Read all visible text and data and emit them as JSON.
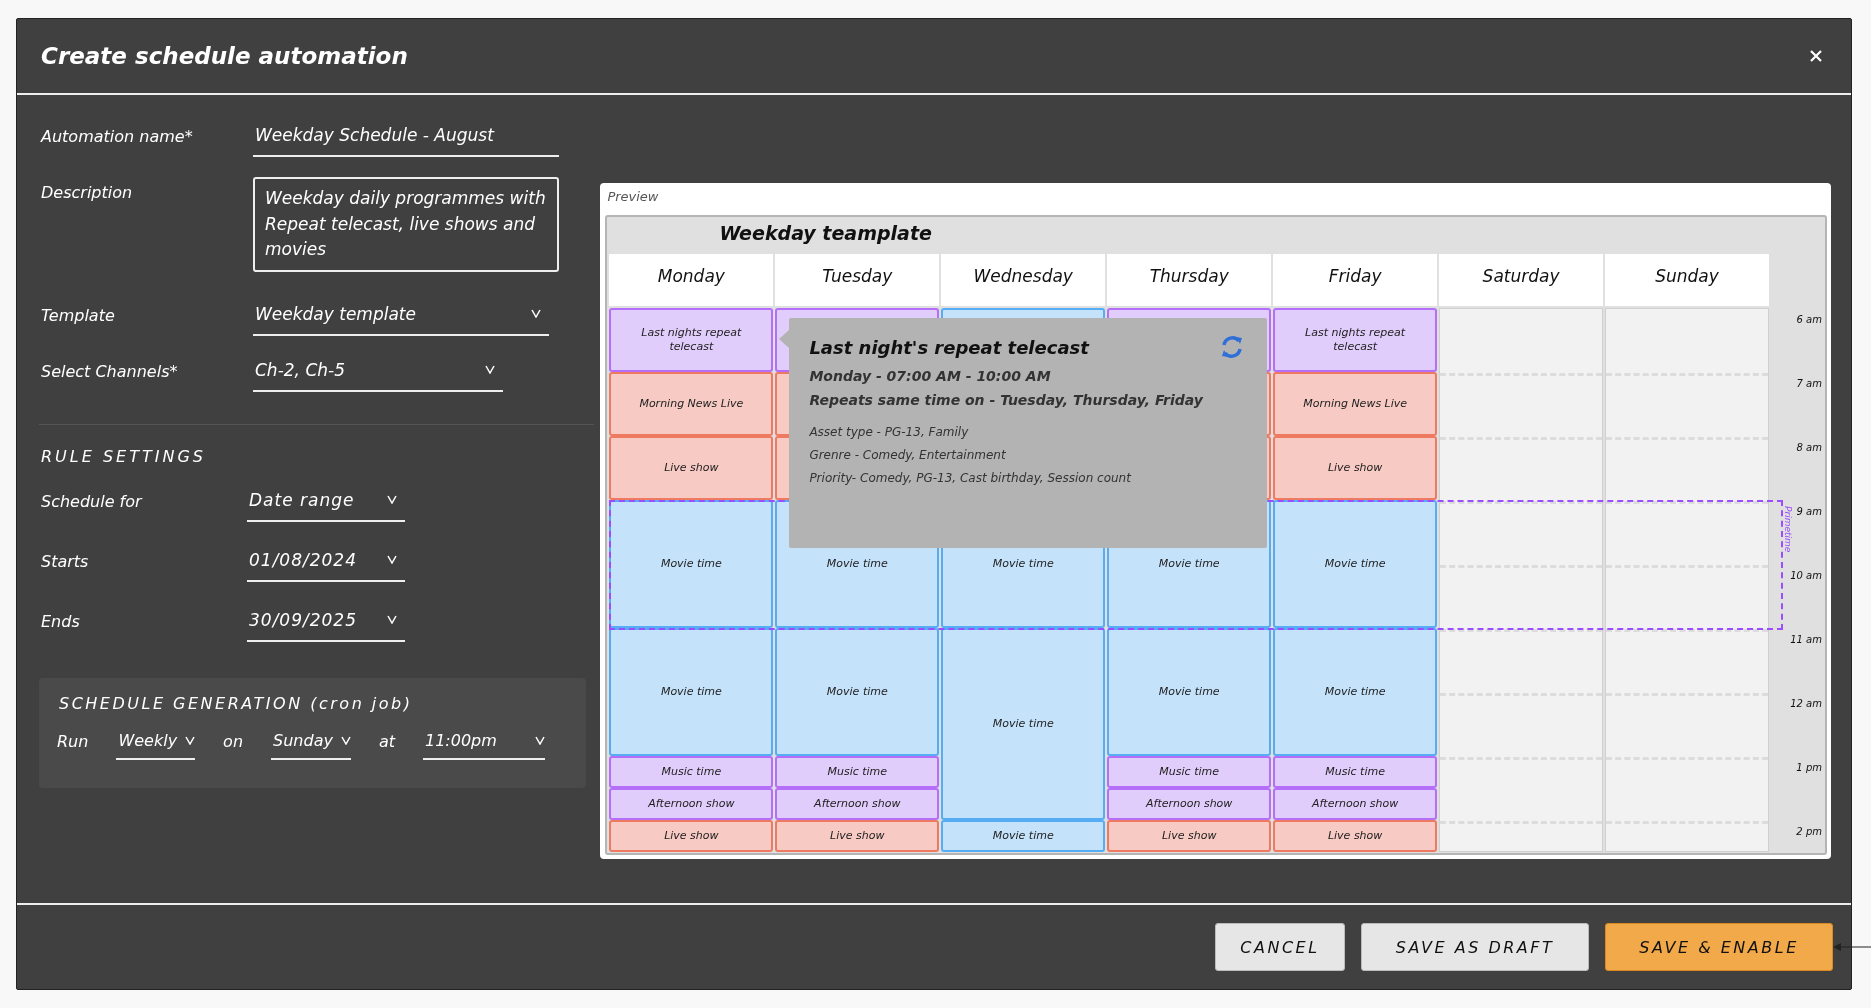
{
  "dialog": {
    "title": "Create schedule automation"
  },
  "form": {
    "fields": [
      {
        "label": "Automation name*",
        "value": "Weekday Schedule - August",
        "kind": "text"
      },
      {
        "label": "Description",
        "value": "Weekday daily programmes with Repeat telecast, live shows and movies",
        "kind": "textarea"
      },
      {
        "label": "Template",
        "value": "Weekday template",
        "kind": "select"
      },
      {
        "label": "Select Channels*",
        "value": "Ch-2, Ch-5",
        "kind": "select"
      }
    ]
  },
  "rule_settings": {
    "heading": "RULE SETTINGS",
    "fields": [
      {
        "label": "Schedule for",
        "value": "Date range"
      },
      {
        "label": "Starts",
        "value": "01/08/2024"
      },
      {
        "label": "Ends",
        "value": "30/09/2025"
      }
    ]
  },
  "schedule_generation": {
    "heading": "SCHEDULE GENERATION (cron job)",
    "parts": [
      {
        "kind": "text",
        "text": "Run"
      },
      {
        "kind": "select",
        "text": "Weekly"
      },
      {
        "kind": "text",
        "text": "on"
      },
      {
        "kind": "select",
        "text": "Sunday"
      },
      {
        "kind": "text",
        "text": "at"
      },
      {
        "kind": "select",
        "text": "11:00pm"
      }
    ]
  },
  "preview": {
    "label": "Preview",
    "calendar": {
      "title": "Weekday teamplate",
      "primetime_label": "Primetime",
      "times": [
        "6 am",
        "7 am",
        "8 am",
        "9 am",
        "10 am",
        "11 am",
        "12 am",
        "1 pm",
        "2 pm"
      ],
      "days": [
        {
          "name": "Monday",
          "events": [
            {
              "label": "Last nights repeat telecast",
              "kind": "repeat"
            },
            {
              "label": "Morning News Live",
              "kind": "live"
            },
            {
              "label": "Live show",
              "kind": "live"
            },
            {
              "label": "Movie time",
              "kind": "movie"
            },
            {
              "label": "Movie time",
              "kind": "movie"
            },
            {
              "label": "Music time",
              "kind": "repeat"
            },
            {
              "label": "Afternoon show",
              "kind": "repeat"
            },
            {
              "label": "Live show",
              "kind": "live"
            }
          ]
        },
        {
          "name": "Tuesday",
          "events": [
            {
              "kind": "repeat"
            },
            {
              "kind": "live"
            },
            {
              "kind": "live"
            },
            {
              "label": "Movie time",
              "kind": "movie"
            },
            {
              "label": "Movie time",
              "kind": "movie"
            },
            {
              "label": "Music time",
              "kind": "repeat"
            },
            {
              "label": "Afternoon show",
              "kind": "repeat"
            },
            {
              "label": "Live show",
              "kind": "live"
            }
          ]
        },
        {
          "name": "Wednesday",
          "events": [
            {
              "kind": "movie"
            },
            {
              "label": "Movie time",
              "kind": "movie"
            },
            {
              "label": "Movie time",
              "kind": "movie"
            },
            {
              "label": "Movie time",
              "kind": "movie"
            }
          ]
        },
        {
          "name": "Thursday",
          "events": [
            {
              "kind": "repeat"
            },
            {
              "kind": "live"
            },
            {
              "kind": "live"
            },
            {
              "label": "Movie time",
              "kind": "movie"
            },
            {
              "label": "Movie time",
              "kind": "movie"
            },
            {
              "label": "Music time",
              "kind": "repeat"
            },
            {
              "label": "Afternoon show",
              "kind": "repeat"
            },
            {
              "label": "Live show",
              "kind": "live"
            }
          ]
        },
        {
          "name": "Friday",
          "events": [
            {
              "label": "Last nights repeat telecast",
              "kind": "repeat"
            },
            {
              "label": "Morning News Live",
              "kind": "live"
            },
            {
              "label": "Live show",
              "kind": "live"
            },
            {
              "label": "Movie time",
              "kind": "movie"
            },
            {
              "label": "Movie time",
              "kind": "movie"
            },
            {
              "label": "Music time",
              "kind": "repeat"
            },
            {
              "label": "Afternoon show",
              "kind": "repeat"
            },
            {
              "label": "Live show",
              "kind": "live"
            }
          ]
        },
        {
          "name": "Saturday"
        },
        {
          "name": "Sunday"
        }
      ]
    },
    "tooltip": {
      "title": "Last night's repeat telecast",
      "when": "Monday - 07:00 AM - 10:00 AM",
      "repeats": "Repeats same time on - Tuesday, Thursday, Friday",
      "details": [
        "Asset type - PG-13, Family",
        "Grenre - Comedy, Entertainment",
        "Priority- Comedy, PG-13, Cast birthday, Session count"
      ]
    }
  },
  "buttons": [
    {
      "label": "CANCEL",
      "kind": "secondary"
    },
    {
      "label": "SAVE AS DRAFT",
      "kind": "secondary"
    },
    {
      "label": "SAVE & ENABLE",
      "kind": "primary"
    }
  ]
}
